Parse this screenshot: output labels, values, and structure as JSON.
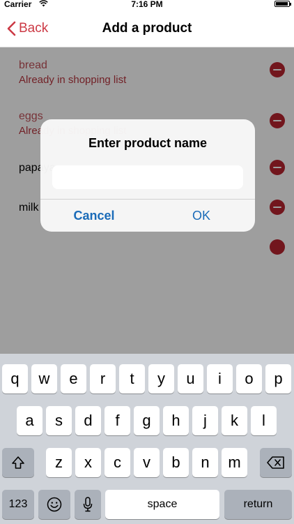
{
  "status_bar": {
    "carrier": "Carrier",
    "time": "7:16 PM",
    "battery_level": 0.95
  },
  "nav": {
    "back_label": "Back",
    "title": "Add a product"
  },
  "products": [
    {
      "name": "bread",
      "note": "Already in shopping list",
      "in_list": true
    },
    {
      "name": "eggs",
      "note": "Already in shopping list",
      "in_list": true
    },
    {
      "name": "papaya",
      "note": "",
      "in_list": false
    },
    {
      "name": "milk",
      "note": "",
      "in_list": false
    }
  ],
  "alert": {
    "title": "Enter product name",
    "input_value": "",
    "input_placeholder": "",
    "cancel_label": "Cancel",
    "ok_label": "OK"
  },
  "keyboard": {
    "row1": [
      "q",
      "w",
      "e",
      "r",
      "t",
      "y",
      "u",
      "i",
      "o",
      "p"
    ],
    "row2": [
      "a",
      "s",
      "d",
      "f",
      "g",
      "h",
      "j",
      "k",
      "l"
    ],
    "row3": [
      "z",
      "x",
      "c",
      "v",
      "b",
      "n",
      "m"
    ],
    "numbers_label": "123",
    "space_label": "space",
    "return_label": "return",
    "icons": {
      "shift": "shift-icon",
      "delete": "backspace-icon",
      "emoji": "emoji-icon",
      "dictation": "microphone-icon"
    }
  },
  "colors": {
    "accent": "#cc3a45",
    "alert_button": "#1a6bb8",
    "remove": "#b8242f"
  }
}
